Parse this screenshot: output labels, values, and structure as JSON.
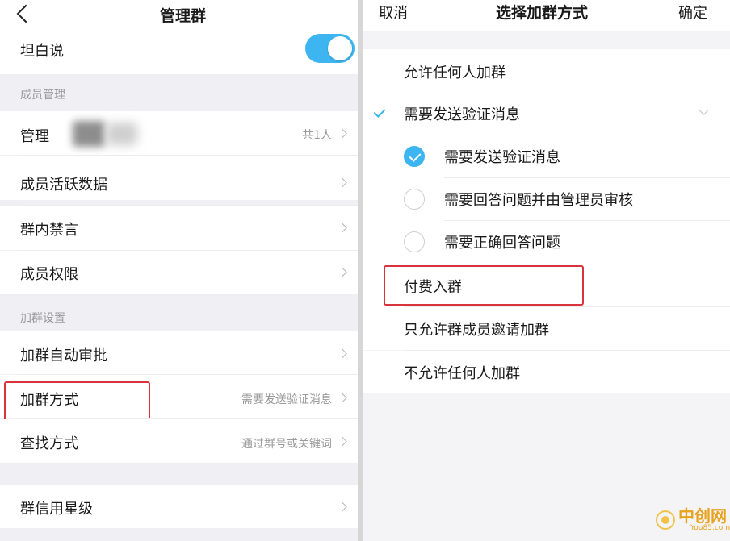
{
  "left": {
    "header": {
      "title": "管理群"
    },
    "rows": {
      "tanbaishuo": {
        "label": "坦白说",
        "toggle_on": true
      },
      "admins": {
        "label": "管理员",
        "value": "共1人"
      },
      "activity": {
        "label": "成员活跃数据"
      },
      "mute": {
        "label": "群内禁言"
      },
      "permissions": {
        "label": "成员权限"
      },
      "auto_approve": {
        "label": "加群自动审批"
      },
      "join_method": {
        "label": "加群方式",
        "value": "需要发送验证消息"
      },
      "search_method": {
        "label": "查找方式",
        "value": "通过群号或关键词"
      },
      "credit_level": {
        "label": "群信用星级"
      }
    },
    "sections": {
      "members": "成员管理",
      "join_settings": "加群设置"
    }
  },
  "right": {
    "header": {
      "cancel": "取消",
      "title": "选择加群方式",
      "confirm": "确定"
    },
    "options": {
      "allow_anyone": "允许任何人加群",
      "need_verify": "需要发送验证消息",
      "sub_send_verify": "需要发送验证消息",
      "sub_answer_review": "需要回答问题并由管理员审核",
      "sub_answer_correct": "需要正确回答问题",
      "paid_join": "付费入群",
      "members_invite_only": "只允许群成员邀请加群",
      "disallow_all": "不允许任何人加群"
    },
    "selected_sub_option": "需要发送验证消息"
  },
  "watermark": {
    "cn": "中创网",
    "en": "You85.com"
  },
  "colors": {
    "accent": "#3cb5f0",
    "highlight_box": "#d9343b",
    "watermark": "#e8a21c"
  },
  "icons": [
    "back-icon",
    "chevron-right-icon",
    "chevron-down-icon",
    "checkmark-icon",
    "radio-icon",
    "toggle-switch"
  ]
}
